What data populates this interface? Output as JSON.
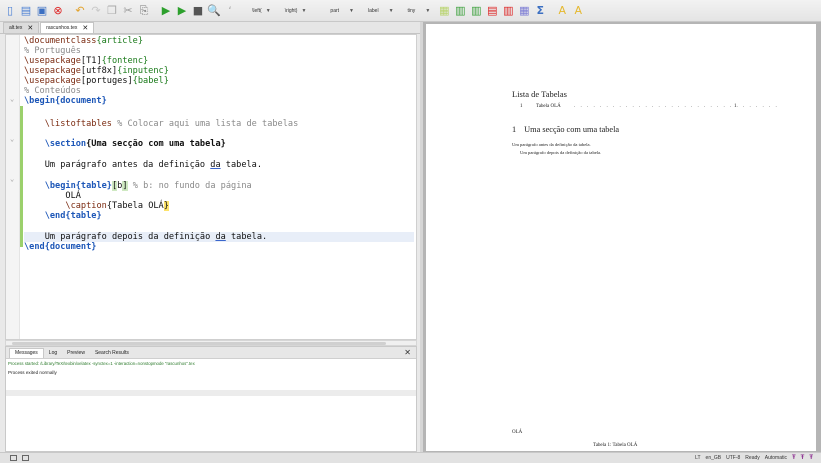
{
  "toolbar": {
    "icons": [
      "new-icon",
      "open-icon",
      "save-icon",
      "stop-icon",
      "undo-icon",
      "redo-icon",
      "copy-icon",
      "cut-icon",
      "paste-icon",
      "typeset-icon",
      "run-icon",
      "stop-typeset-icon",
      "zoom-icon",
      "spell-icon"
    ],
    "selects": [
      {
        "label": "\\left(",
        "name": "left-delimiter-select"
      },
      {
        "label": "\\right)",
        "name": "right-delimiter-select"
      },
      {
        "label": "part",
        "name": "section-select"
      },
      {
        "label": "label",
        "name": "label-select"
      },
      {
        "label": "tiny",
        "name": "size-select"
      }
    ],
    "symbols": [
      "A",
      "A"
    ]
  },
  "tabs": [
    {
      "label": "alt.tex",
      "active": false
    },
    {
      "label": "rascunhos.tex",
      "active": true
    }
  ],
  "editor": {
    "lines": {
      "l1": "\\documentclass{article}",
      "l2": "% Português",
      "l3": "\\usepackage[T1]{fontenc}",
      "l4": "\\usepackage[utf8x]{inputenc}",
      "l5": "\\usepackage[portuges]{babel}",
      "l6": "% Conteúdos",
      "l7": "\\begin{document}",
      "l9": "\\listoftables % Colocar aqui uma lista de tabelas",
      "l11": "\\section{Uma secção com uma tabela}",
      "l13": "Um parágrafo antes da definição da tabela.",
      "l15": "\\begin{table}[b] % b: no fundo da página",
      "l16": "OLÁ",
      "l17": "\\caption{Tabela OLÁ}",
      "l18": "\\end{table}",
      "l20": "Um parágrafo depois da definição da tabela.",
      "l21": "\\end{document}"
    }
  },
  "panel": {
    "tabs": [
      "Messages",
      "Log",
      "Preview",
      "Search Results"
    ],
    "close": "✕",
    "messages": [
      "Process started: /Library/TeX/texbin/xelatex -synctex=1 -interaction=nonstopmode \"rascunhos\".tex",
      "Process exited normally"
    ]
  },
  "statusbar": {
    "lt": "LT",
    "lang": "en_GB",
    "encoding": "UTF-8",
    "ready": "Ready",
    "mode": "Automatic"
  },
  "pdf": {
    "lot_title": "Lista de Tabelas",
    "lot_num": "1",
    "lot_label": "Tabela OLÁ",
    "lot_page": "1",
    "section_num": "1",
    "section_title": "Uma secção com uma tabela",
    "p1": "Um parágrafo antes da definição da tabela.",
    "p2": "Um parágrafo depois da definição da tabela.",
    "table_content": "OLÁ",
    "caption": "Tabela 1: Tabela OLÁ"
  }
}
